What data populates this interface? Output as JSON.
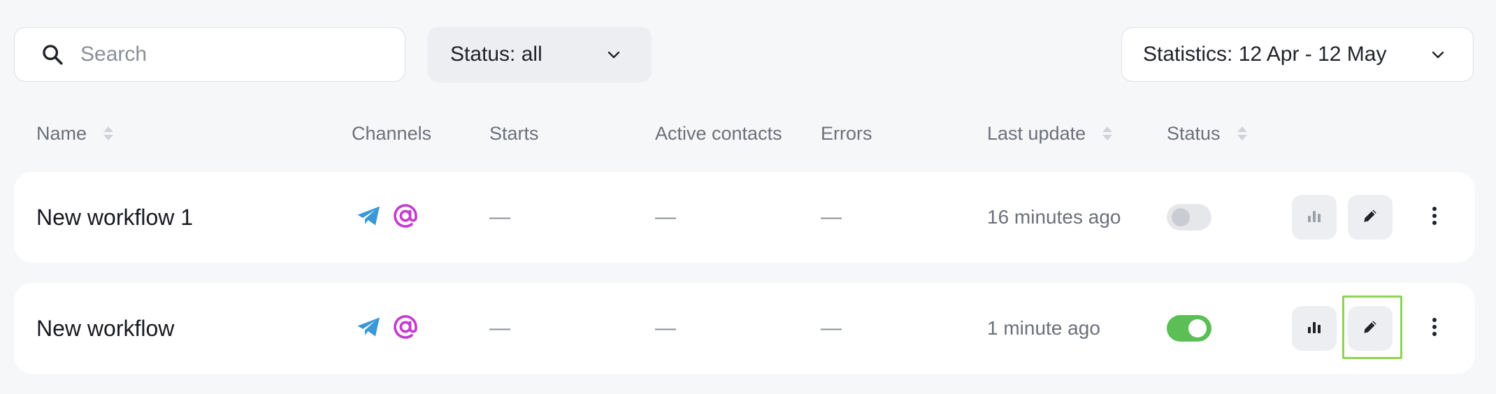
{
  "filters": {
    "search_placeholder": "Search",
    "status_label": "Status: all",
    "statistics_label": "Statistics: 12 Apr - 12 May"
  },
  "columns": {
    "name": "Name",
    "channels": "Channels",
    "starts": "Starts",
    "active_contacts": "Active contacts",
    "errors": "Errors",
    "last_update": "Last update",
    "status": "Status"
  },
  "rows": [
    {
      "name": "New workflow 1",
      "channels": [
        "telegram",
        "email"
      ],
      "starts": "—",
      "active_contacts": "—",
      "errors": "—",
      "last_update": "16 minutes ago",
      "status_enabled": false
    },
    {
      "name": "New workflow",
      "channels": [
        "telegram",
        "email"
      ],
      "starts": "—",
      "active_contacts": "—",
      "errors": "—",
      "last_update": "1 minute ago",
      "status_enabled": true
    }
  ],
  "icons": {
    "search": "search-icon",
    "chevron": "chevron-down-icon",
    "telegram": "telegram-icon",
    "email": "at-sign-icon",
    "stats": "bar-chart-icon",
    "edit": "pencil-icon",
    "more": "kebab-menu-icon"
  },
  "colors": {
    "telegram": "#3a98d8",
    "email": "#c43bd0",
    "toggle_on": "#5bbf55",
    "highlight": "#8ed453"
  }
}
